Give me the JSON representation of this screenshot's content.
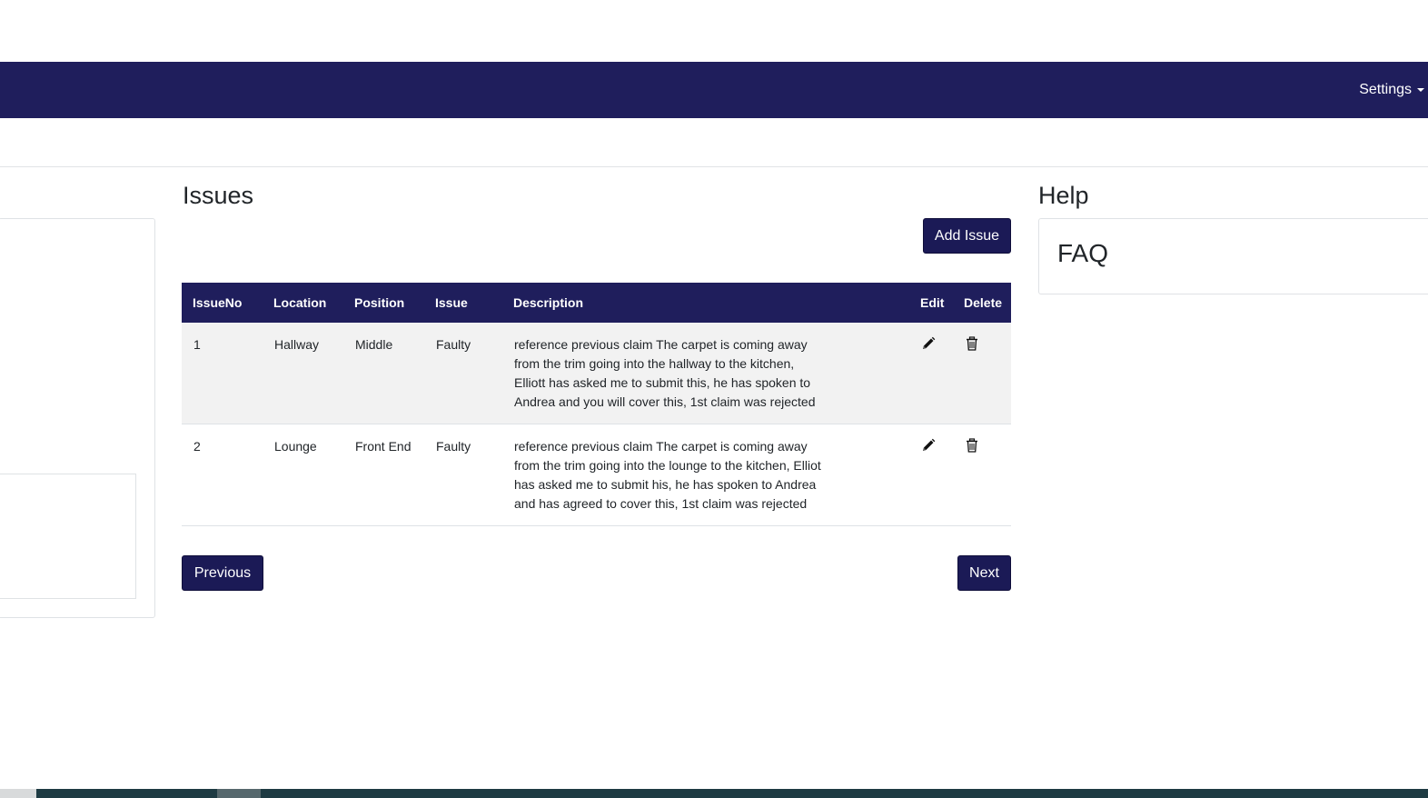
{
  "navbar": {
    "settings_label": "Settings"
  },
  "issues": {
    "title": "Issues",
    "add_button": "Add Issue",
    "columns": [
      "IssueNo",
      "Location",
      "Position",
      "Issue",
      "Description",
      "Edit",
      "Delete"
    ],
    "rows": [
      {
        "no": "1",
        "location": "Hallway",
        "position": "Middle",
        "issue": "Faulty",
        "description": "reference previous claim The carpet is coming away from the trim going into the hallway to the kitchen, Elliott has asked me to submit this, he has spoken to Andrea and you will cover this, 1st claim was rejected"
      },
      {
        "no": "2",
        "location": "Lounge",
        "position": "Front End",
        "issue": "Faulty",
        "description": "reference previous claim The carpet is coming away from the trim going into the lounge to the kitchen, Elliot has asked me to submit his, he has spoken to Andrea and has agreed to cover this, 1st claim was rejected"
      }
    ],
    "icons": {
      "edit": "pencil-icon",
      "delete": "trash-icon"
    }
  },
  "pagination": {
    "previous": "Previous",
    "next": "Next"
  },
  "help": {
    "title": "Help",
    "faq": "FAQ"
  },
  "colors": {
    "navbar": "#1f1e5c",
    "button": "#1b1a56",
    "row_alt": "#f2f2f2"
  }
}
